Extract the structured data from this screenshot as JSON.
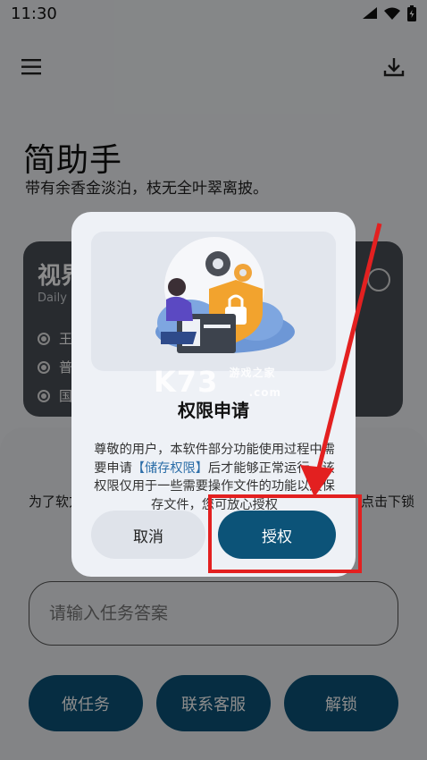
{
  "status_bar": {
    "time": "11:30"
  },
  "header": {
    "title": "简助手",
    "subtitle": "带有余香金淡泊，枝无全叶翠离披。"
  },
  "card": {
    "title": "视界",
    "subtitle": "Daily N",
    "items": [
      {
        "label": "王"
      },
      {
        "label": "普"
      },
      {
        "label": "国"
      }
    ]
  },
  "notice": {
    "left": "为了软方",
    "right": "点击下锁"
  },
  "task": {
    "placeholder": "请输入任务答案"
  },
  "actions": {
    "do_task": "做任务",
    "contact": "联系客服",
    "unlock": "解锁"
  },
  "dialog": {
    "title": "权限申请",
    "body_before": "尊敬的用户，本软件部分功能使用过程中需要申请",
    "body_highlight": "【储存权限】",
    "body_after": "后才能够正常运行，该权限仅用于一些需要操作文件的功能以及保存文件，您可放心授权",
    "cancel": "取消",
    "grant": "授权"
  },
  "watermark": {
    "logo_text": "K73",
    "site": "游戏之家",
    "domain": ".com"
  },
  "colors": {
    "primary": "#0c5378",
    "highlight_text": "#2c6ea8",
    "annotation_red": "#e32020"
  }
}
